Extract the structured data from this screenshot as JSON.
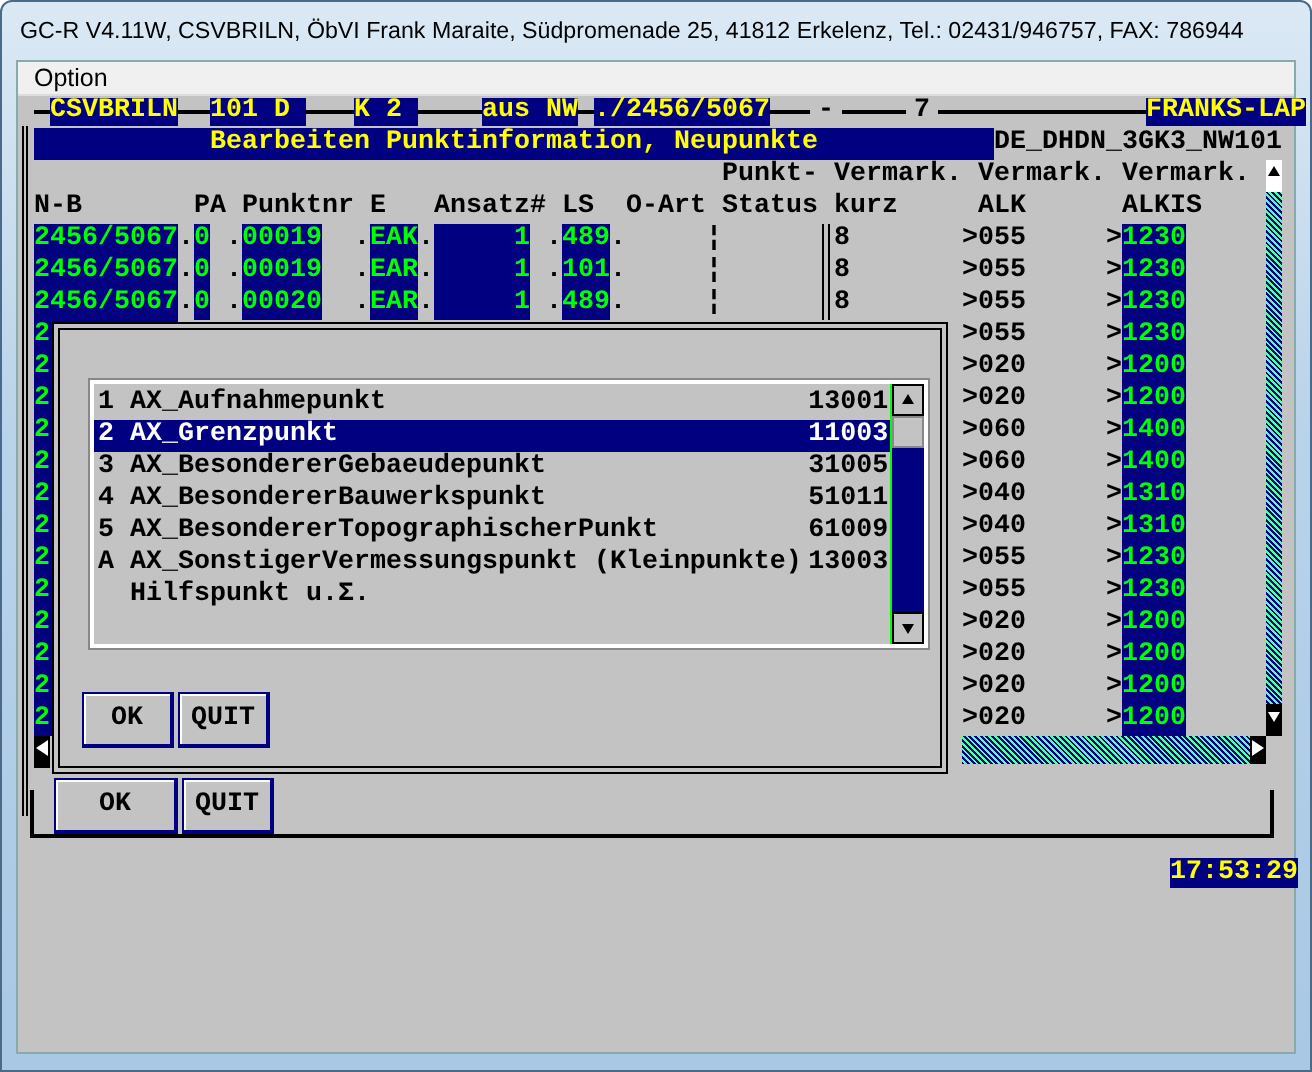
{
  "window": {
    "title": "GC-R V4.11W, CSVBRILN, ÖbVI Frank Maraite, Südpromenade 25, 41812 Erkelenz, Tel.: 02431/946757, FAX: 786944"
  },
  "menu": [
    {
      "label": "Option"
    }
  ],
  "header_fields": [
    {
      "text": "CSVBRILN",
      "kind": "field"
    },
    {
      "text": "101 D",
      "kind": "field"
    },
    {
      "text": "K 2",
      "kind": "field"
    },
    {
      "text": "aus NW",
      "kind": "field"
    },
    {
      "text": "./2456/5067",
      "kind": "field"
    },
    {
      "text": "-",
      "kind": "plain"
    },
    {
      "text": "7",
      "kind": "plain"
    },
    {
      "text": "FRANKS-LAP",
      "kind": "field"
    }
  ],
  "screen_title": "Bearbeiten Punktinformation, Neupunkte",
  "coordinate_system": "DE_DHDN_3GK3_NW101",
  "columns": [
    {
      "label": "N-B"
    },
    {
      "label": "PA"
    },
    {
      "label": "Punktnr"
    },
    {
      "label": "E"
    },
    {
      "label": "Ansatz#"
    },
    {
      "label": "LS"
    },
    {
      "label": "O-Art"
    },
    {
      "top": "Punkt-",
      "label": "Status"
    },
    {
      "top": "Vermark.",
      "label": "kurz"
    },
    {
      "top": "Vermark.",
      "label": "ALK"
    },
    {
      "top": "Vermark.",
      "label": "ALKIS"
    }
  ],
  "rows": [
    {
      "nb": "2456/5067",
      "pa": "0",
      "punktnr": "00019",
      "e": "EAK",
      "ansatz": "1",
      "ls": "489",
      "status": "¦",
      "kurz": "8",
      "alk": ">055",
      "alkis_prefix": ">",
      "alkis": "1230",
      "separators": [
        ".",
        ".",
        ".",
        ".",
        ".",
        "."
      ]
    },
    {
      "nb": "2456/5067",
      "pa": "0",
      "punktnr": "00019",
      "e": "EAR",
      "ansatz": "1",
      "ls": "101",
      "status": "¦",
      "kurz": "8",
      "alk": ">055",
      "alkis_prefix": ">",
      "alkis": "1230",
      "separators": [
        ".",
        ".",
        ".",
        ".",
        ".",
        "."
      ]
    },
    {
      "nb": "2456/5067",
      "pa": "0",
      "punktnr": "00020",
      "e": "EAR",
      "ansatz": "1",
      "ls": "489",
      "status": "¦",
      "kurz": "8",
      "alk": ">055",
      "alkis_prefix": ">",
      "alkis": "1230",
      "separators": [
        ".",
        ".",
        ".",
        ".",
        ".",
        "."
      ]
    },
    {
      "nb": "2",
      "alk": ">055",
      "alkis_prefix": ">",
      "alkis": "1230"
    },
    {
      "nb": "2",
      "alk": ">020",
      "alkis_prefix": ">",
      "alkis": "1200"
    },
    {
      "nb": "2",
      "alk": ">020",
      "alkis_prefix": ">",
      "alkis": "1200"
    },
    {
      "nb": "2",
      "alk": ">060",
      "alkis_prefix": ">",
      "alkis": "1400"
    },
    {
      "nb": "2",
      "alk": ">060",
      "alkis_prefix": ">",
      "alkis": "1400"
    },
    {
      "nb": "2",
      "alk": ">040",
      "alkis_prefix": ">",
      "alkis": "1310"
    },
    {
      "nb": "2",
      "alk": ">040",
      "alkis_prefix": ">",
      "alkis": "1310"
    },
    {
      "nb": "2",
      "alk": ">055",
      "alkis_prefix": ">",
      "alkis": "1230"
    },
    {
      "nb": "2",
      "alk": ">055",
      "alkis_prefix": ">",
      "alkis": "1230"
    },
    {
      "nb": "2",
      "alk": ">020",
      "alkis_prefix": ">",
      "alkis": "1200"
    },
    {
      "nb": "2",
      "alk": ">020",
      "alkis_prefix": ">",
      "alkis": "1200"
    },
    {
      "nb": "2",
      "alk": ">020",
      "alkis_prefix": ">",
      "alkis": "1200"
    },
    {
      "nb": "2",
      "alk": ">020",
      "alkis_prefix": ">",
      "alkis": "1200"
    }
  ],
  "buttons": [
    {
      "label": "OK"
    },
    {
      "label": "QUIT"
    }
  ],
  "clock": "17:53:29",
  "dialog": {
    "items": [
      {
        "key": "1",
        "label": "AX_Aufnahmepunkt",
        "code": "13001",
        "selected": false
      },
      {
        "key": "2",
        "label": "AX_Grenzpunkt",
        "code": "11003",
        "selected": true
      },
      {
        "key": "3",
        "label": "AX_BesondererGebaeudepunkt",
        "code": "31005",
        "selected": false
      },
      {
        "key": "4",
        "label": "AX_BesondererBauwerkspunkt",
        "code": "51011",
        "selected": false
      },
      {
        "key": "5",
        "label": "AX_BesondererTopographischerPunkt",
        "code": "61009",
        "selected": false
      },
      {
        "key": "A",
        "label": "AX_SonstigerVermessungspunkt (Kleinpunkte)",
        "code": "13003",
        "note": "Hilfspunkt u.Σ.",
        "selected": false
      }
    ],
    "buttons": [
      {
        "label": "OK"
      },
      {
        "label": "QUIT"
      }
    ]
  }
}
